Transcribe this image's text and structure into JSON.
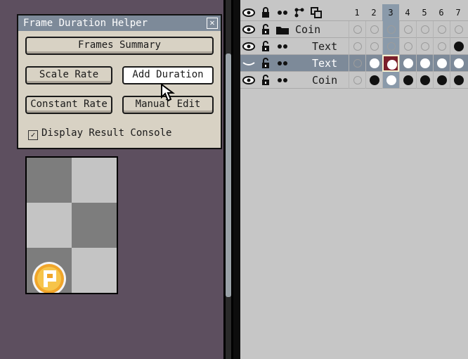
{
  "dialog": {
    "title": "Frame Duration Helper",
    "close_icon": "close-x-icon",
    "buttons": {
      "frames_summary": "Frames Summary",
      "scale_rate": "Scale Rate",
      "add_duration": "Add Duration",
      "constant_rate": "Constant Rate",
      "manual_edit": "Manual Edit"
    },
    "checkbox": {
      "label": "Display Result Console",
      "checked": true
    }
  },
  "timeline": {
    "header_icons": [
      "eye-icon",
      "lock-icon",
      "continuous-icon",
      "link-icon",
      "layers-icon"
    ],
    "frame_numbers": [
      "1",
      "2",
      "3",
      "4",
      "5",
      "6",
      "7"
    ],
    "current_frame": "3",
    "layers": [
      {
        "name": "Coin",
        "type": "group",
        "visible_icon": "eye-icon",
        "lock_icon": "unlock-icon",
        "extra_icon": "folder-icon",
        "cels": [
          "empty",
          "empty",
          "empty",
          "empty",
          "empty",
          "empty",
          "empty"
        ],
        "selected": false,
        "indent": false
      },
      {
        "name": "Text",
        "type": "layer",
        "visible_icon": "eye-icon",
        "lock_icon": "unlock-icon",
        "extra_icon": "continuous-icon",
        "cels": [
          "empty",
          "empty",
          "empty",
          "empty",
          "empty",
          "empty",
          "black"
        ],
        "selected": false,
        "indent": true
      },
      {
        "name": "Text",
        "type": "layer",
        "visible_icon": "closed-eye-icon",
        "lock_icon": "unlock-icon",
        "extra_icon": "continuous-icon",
        "cels": [
          "empty",
          "white",
          "white",
          "white",
          "white",
          "white",
          "white"
        ],
        "selected": true,
        "indent": true
      },
      {
        "name": "Coin",
        "type": "layer",
        "visible_icon": "eye-icon",
        "lock_icon": "unlock-icon",
        "extra_icon": "continuous-icon",
        "cels": [
          "empty",
          "black",
          "white",
          "black",
          "black",
          "black",
          "black"
        ],
        "selected": false,
        "indent": true
      }
    ]
  },
  "colors": {
    "workspace_bg": "#5d4f5f",
    "dialog_title_bg": "#7d8a99",
    "selected_row_bg": "#7d8a99",
    "current_frame_col": "#8a9aaa",
    "active_cel_border": "#7a1f2a"
  }
}
